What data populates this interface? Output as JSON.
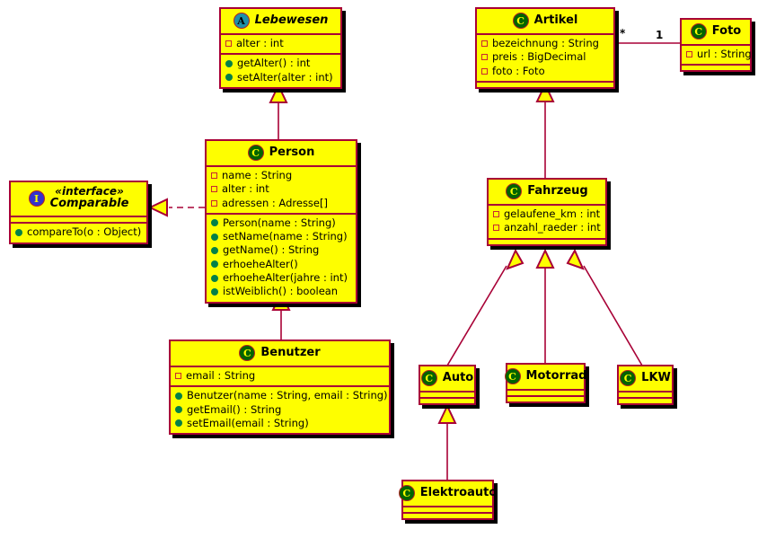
{
  "diagram": {
    "title": "UML Class Diagram",
    "background": "#ffffff",
    "node_fill": "#FEFE00",
    "node_border": "#A80036",
    "line_color": "#A80036"
  },
  "nodes": {
    "lebewesen": {
      "name": "Lebewesen",
      "icon": "abstract-class-icon",
      "icon_letter": "A",
      "attributes": [
        {
          "visibility": "private",
          "text": "alter : int"
        }
      ],
      "methods": [
        {
          "visibility": "public",
          "text": "getAlter() : int"
        },
        {
          "visibility": "public",
          "text": "setAlter(alter : int)"
        }
      ]
    },
    "person": {
      "name": "Person",
      "icon": "class-icon",
      "icon_letter": "C",
      "attributes": [
        {
          "visibility": "private",
          "text": "name : String"
        },
        {
          "visibility": "private",
          "text": "alter : int"
        },
        {
          "visibility": "private",
          "text": "adressen : Adresse[]"
        }
      ],
      "methods": [
        {
          "visibility": "public",
          "text": "Person(name : String)"
        },
        {
          "visibility": "public",
          "text": "setName(name : String)"
        },
        {
          "visibility": "public",
          "text": "getName() : String"
        },
        {
          "visibility": "public",
          "text": "erhoeheAlter()"
        },
        {
          "visibility": "public",
          "text": "erhoeheAlter(jahre : int)"
        },
        {
          "visibility": "public",
          "text": "istWeiblich() : boolean"
        }
      ]
    },
    "comparable": {
      "stereotype": "«interface»",
      "name": "Comparable",
      "icon": "interface-icon",
      "icon_letter": "I",
      "attributes": [],
      "methods": [
        {
          "visibility": "public",
          "text": "compareTo(o : Object)"
        }
      ]
    },
    "benutzer": {
      "name": "Benutzer",
      "icon": "class-icon",
      "icon_letter": "C",
      "attributes": [
        {
          "visibility": "private",
          "text": "email : String"
        }
      ],
      "methods": [
        {
          "visibility": "public",
          "text": "Benutzer(name : String, email : String)"
        },
        {
          "visibility": "public",
          "text": "getEmail() : String"
        },
        {
          "visibility": "public",
          "text": "setEmail(email : String)"
        }
      ]
    },
    "artikel": {
      "name": "Artikel",
      "icon": "class-icon",
      "icon_letter": "C",
      "attributes": [
        {
          "visibility": "private",
          "text": "bezeichnung : String"
        },
        {
          "visibility": "private",
          "text": "preis : BigDecimal"
        },
        {
          "visibility": "private",
          "text": "foto : Foto"
        }
      ],
      "methods": []
    },
    "foto": {
      "name": "Foto",
      "icon": "class-icon",
      "icon_letter": "C",
      "attributes": [
        {
          "visibility": "private",
          "text": "url : String"
        }
      ],
      "methods": []
    },
    "fahrzeug": {
      "name": "Fahrzeug",
      "icon": "class-icon",
      "icon_letter": "C",
      "attributes": [
        {
          "visibility": "private",
          "text": "gelaufene_km : int"
        },
        {
          "visibility": "private",
          "text": "anzahl_raeder : int"
        }
      ],
      "methods": []
    },
    "auto": {
      "name": "Auto",
      "icon": "class-icon",
      "icon_letter": "C",
      "attributes": [],
      "methods": []
    },
    "motorrad": {
      "name": "Motorrad",
      "icon": "class-icon",
      "icon_letter": "C",
      "attributes": [],
      "methods": []
    },
    "lkw": {
      "name": "LKW",
      "icon": "class-icon",
      "icon_letter": "C",
      "attributes": [],
      "methods": []
    },
    "elektroauto": {
      "name": "Elektroauto",
      "icon": "class-icon",
      "icon_letter": "C",
      "attributes": [],
      "methods": []
    }
  },
  "relations": {
    "person_extends_lebewesen": {
      "kind": "generalization"
    },
    "person_implements_comparable": {
      "kind": "realization"
    },
    "benutzer_extends_person": {
      "kind": "generalization"
    },
    "fahrzeug_extends_artikel": {
      "kind": "generalization"
    },
    "artikel_has_foto": {
      "kind": "association",
      "source_multiplicity": "*",
      "target_multiplicity": "1"
    },
    "auto_extends_fahrzeug": {
      "kind": "generalization"
    },
    "motorrad_extends_fahrzeug": {
      "kind": "generalization"
    },
    "lkw_extends_fahrzeug": {
      "kind": "generalization"
    },
    "elektroauto_extends_auto": {
      "kind": "generalization"
    }
  }
}
